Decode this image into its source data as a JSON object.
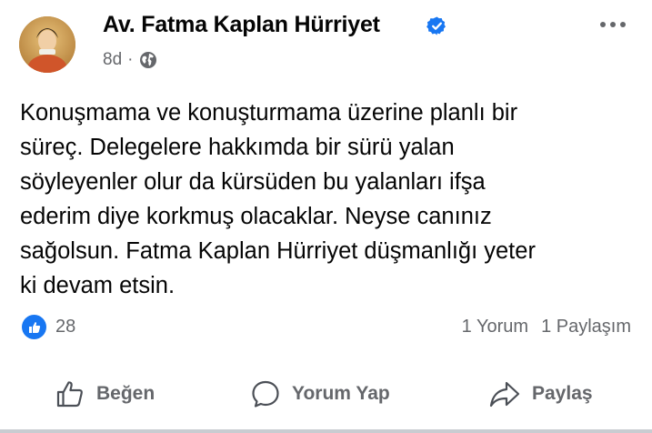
{
  "post": {
    "author": "Av. Fatma Kaplan Hürriyet",
    "timestamp": "8d",
    "separator": "·",
    "privacy_icon": "globe-icon",
    "verified_icon": "verified-badge-icon",
    "text_lines": [
      "Konuşmama ve konuşturmama üzerine planlı bir",
      "süreç. Delegelere hakkımda bir sürü yalan",
      "söyleyenler olur da kürsüden bu yalanları ifşa",
      "ederim diye korkmuş olacaklar. Neyse canınız",
      "sağolsun. Fatma Kaplan Hürriyet düşmanlığı yeter",
      "ki devam etsin."
    ]
  },
  "engagement": {
    "reaction_icon": "like-icon",
    "reaction_count": "28",
    "comments": "1 Yorum",
    "shares": "1 Paylaşım"
  },
  "actions": {
    "like": "Beğen",
    "comment": "Yorum Yap",
    "share": "Paylaş"
  },
  "colors": {
    "text": "#050505",
    "secondary": "#65676b",
    "accent": "#1877f2"
  }
}
